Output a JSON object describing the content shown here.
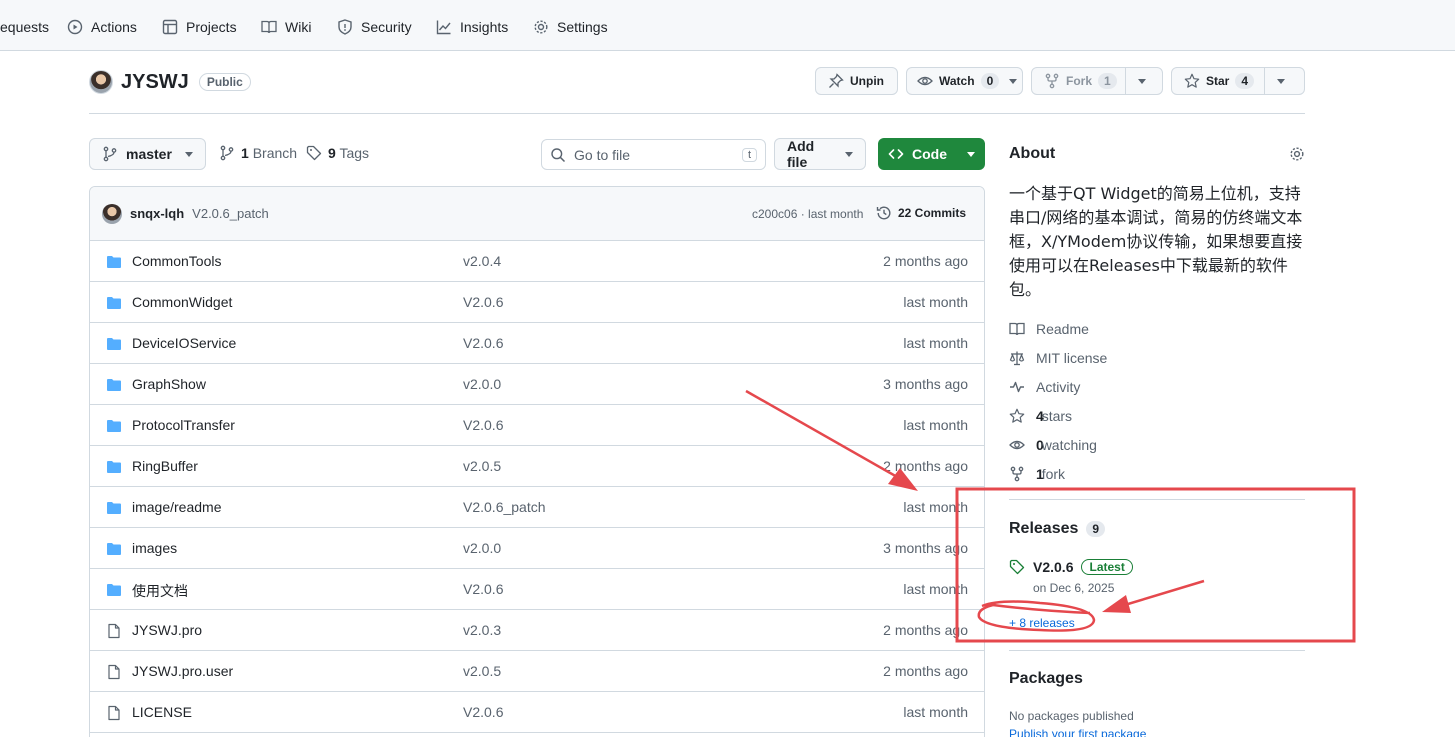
{
  "nav": {
    "items": [
      "equests",
      "Actions",
      "Projects",
      "Wiki",
      "Security",
      "Insights",
      "Settings"
    ]
  },
  "repo": {
    "name": "JYSWJ",
    "visibility": "Public",
    "unpin_label": "Unpin",
    "watch_label": "Watch",
    "watch_count": "0",
    "fork_label": "Fork",
    "fork_count": "1",
    "star_label": "Star",
    "star_count": "4"
  },
  "toolbar": {
    "branch": "master",
    "branch_count": "1",
    "branch_label": "Branch",
    "tag_count": "9",
    "tag_label": "Tags",
    "search_placeholder": "Go to file",
    "search_shortcut": "t",
    "add_file_label": "Add file",
    "code_label": "Code"
  },
  "commit": {
    "author": "snqx-lqh",
    "message": "V2.0.6_patch",
    "hash_time": "c200c06 · last month",
    "count_label": "22 Commits"
  },
  "files": [
    {
      "name": "CommonTools",
      "type": "folder",
      "message": "v2.0.4",
      "date": "2 months ago"
    },
    {
      "name": "CommonWidget",
      "type": "folder",
      "message": "V2.0.6",
      "date": "last month"
    },
    {
      "name": "DeviceIOService",
      "type": "folder",
      "message": "V2.0.6",
      "date": "last month"
    },
    {
      "name": "GraphShow",
      "type": "folder",
      "message": "v2.0.0",
      "date": "3 months ago"
    },
    {
      "name": "ProtocolTransfer",
      "type": "folder",
      "message": "V2.0.6",
      "date": "last month"
    },
    {
      "name": "RingBuffer",
      "type": "folder",
      "message": "v2.0.5",
      "date": "2 months ago"
    },
    {
      "name": "image/readme",
      "type": "folder",
      "message": "V2.0.6_patch",
      "date": "last month"
    },
    {
      "name": "images",
      "type": "folder",
      "message": "v2.0.0",
      "date": "3 months ago"
    },
    {
      "name": "使用文档",
      "type": "folder",
      "message": "V2.0.6",
      "date": "last month"
    },
    {
      "name": "JYSWJ.pro",
      "type": "file",
      "message": "v2.0.3",
      "date": "2 months ago"
    },
    {
      "name": "JYSWJ.pro.user",
      "type": "file",
      "message": "v2.0.5",
      "date": "2 months ago"
    },
    {
      "name": "LICENSE",
      "type": "file",
      "message": "V2.0.6",
      "date": "last month"
    }
  ],
  "about": {
    "title": "About",
    "description_lines": [
      "一个基于QT Widget的简易上位机，支持",
      "串口/网络的基本调试，简易的仿终端文本",
      "框，X/YModem协议传输，如果想要直接",
      "使用可以在Releases中下载最新的软件",
      "包。"
    ],
    "readme": "Readme",
    "license": "MIT license",
    "activity": "Activity",
    "stars_count": "4",
    "stars_label": "stars",
    "watching_count": "0",
    "watching_label": "watching",
    "fork_count": "1",
    "fork_label": "fork"
  },
  "releases": {
    "title": "Releases",
    "count": "9",
    "latest_name": "V2.0.6",
    "latest_badge": "Latest",
    "latest_date": "on Dec 6, 2025",
    "more_link": "+ 8 releases"
  },
  "packages": {
    "title": "Packages",
    "none_text": "No packages published",
    "publish_link": "Publish your first package"
  },
  "colors": {
    "accent_green": "#1f883d",
    "link_blue": "#0969da",
    "folder_blue": "#54aeff",
    "annotation_red": "#e5484d"
  }
}
